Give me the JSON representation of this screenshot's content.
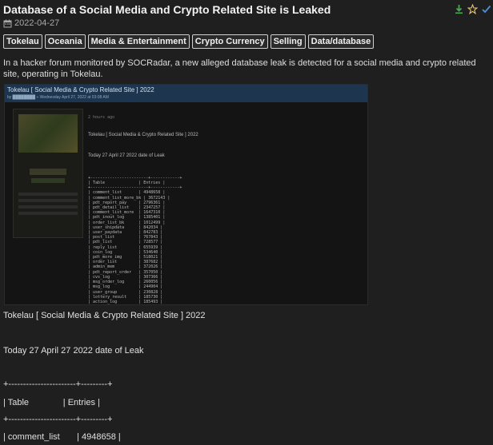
{
  "title": "Database of a Social Media and Crypto Related Site is Leaked",
  "date": "2022-04-27",
  "tags": [
    "Tokelau",
    "Oceania",
    "Media & Entertainment",
    "Crypto Currency",
    "Selling",
    "Data/database"
  ],
  "description": "In a hacker forum monitored by SOCRadar, a new alleged database leak is detected for a social media and crypto related site, operating in Tokelau.",
  "screenshot": {
    "header_title": "Tokelau [ Social Media & Crypto Related Site ] 2022",
    "header_sub": "by ████████ » Wednesday April 27, 2022 at 03:08 AM",
    "time_ago": "2 hours ago",
    "post_title": "Tokelau [ Social Media & Crypto Related Site ] 2022",
    "post_date": "Today 27 April 27 2022 date of Leak",
    "lines": [
      "+------------------------+------------+",
      "| Table              | Entries |",
      "+------------------------+------------+",
      "| comment_list       | 4948658 |",
      "| comment_list_more_bk | 3672143 |",
      "| pdt_report_pay     | 2796361 |",
      "| pdt_detail_list    | 2347257 |",
      "| comment_list_more  | 1647310 |",
      "| pdt_inout_log      | 1385401 |",
      "| order_list_bk      | 1012499 |",
      "| user_shipdata      | 842034 |",
      "| user_paydata       | 842783 |",
      "| post_list          | 767843 |",
      "| pdt_list           | 728577 |",
      "| reply_list         | 655939 |",
      "| coin_log           | 534640 |",
      "| pdt_more_img       | 518021 |",
      "| order_list         | 387682 |",
      "| admin_mem          | 372026 |",
      "| pdt_report_order   | 357050 |",
      "| cvs_log            | 307366 |",
      "| msg_order_log      | 260056 |",
      "| msg_log            | 244904 |",
      "| user_group         | 230828 |",
      "| lottery_result     | 185730 |",
      "| action_log         | 185493 |",
      "| class_pdt          | 93024 |",
      "| pay_list           | 80046 |",
      "| line_order_log     | 63929 |",
      "| cvs_list           | 63074 |"
    ]
  },
  "post": {
    "heading": "Tokelau [ Social Media & Crypto Related Site ] 2022",
    "date_line": "Today 27 April 27 2022 date of Leak",
    "rule1": "+-----------------------+---------+",
    "header_row": "| Table              | Entries |",
    "rule2": "+-----------------------+---------+",
    "row1": "| comment_list       | 4948658 |"
  },
  "icons": {
    "download": "download-icon",
    "star": "star-icon",
    "check": "check-icon",
    "calendar": "calendar-icon"
  },
  "colors": {
    "background": "#1f1f1f",
    "download": "#3fae49",
    "star": "#e9c46a",
    "check": "#4a90d9"
  }
}
